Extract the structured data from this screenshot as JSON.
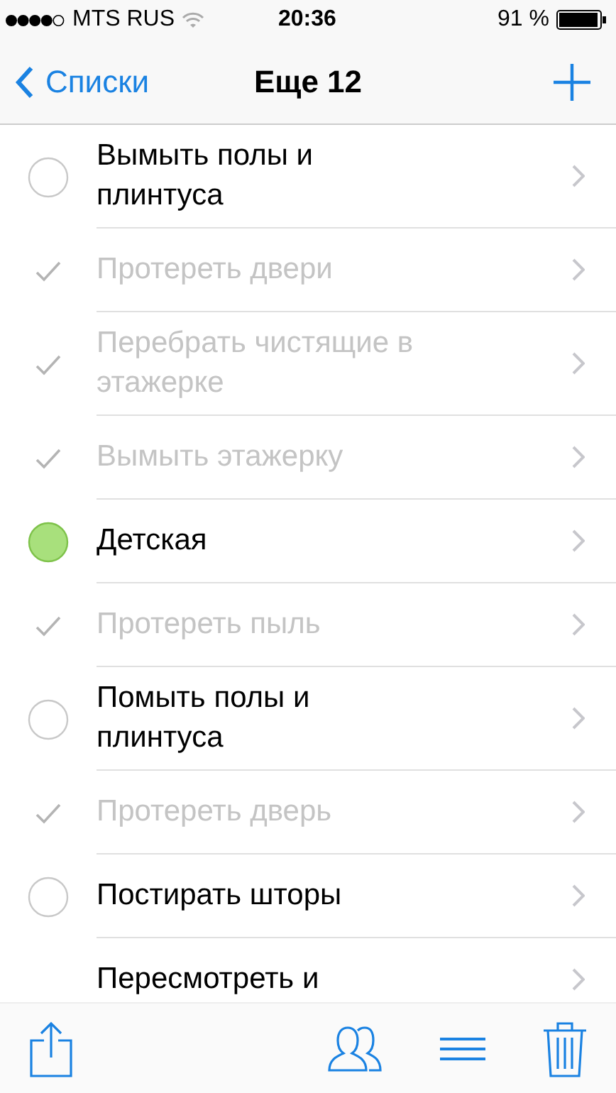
{
  "status_bar": {
    "carrier": "MTS RUS",
    "time": "20:36",
    "battery": "91 %"
  },
  "nav": {
    "back": "Списки",
    "title": "Еще 12"
  },
  "items": [
    {
      "text": "Вымыть полы и плинтуса",
      "done": false
    },
    {
      "text": "Протереть двери",
      "done": true
    },
    {
      "text": "Перебрать чистящие  в этажерке",
      "done": true
    },
    {
      "text": "Вымыть этажерку",
      "done": true
    },
    {
      "text": "Детская",
      "done": false,
      "color": "#a8e07c"
    },
    {
      "text": "Протереть пыль",
      "done": true
    },
    {
      "text": "Помыть полы и плинтуса",
      "done": false
    },
    {
      "text": "Протереть дверь",
      "done": true
    },
    {
      "text": "Постирать шторы",
      "done": false
    },
    {
      "text": "Пересмотреть и"
    }
  ]
}
